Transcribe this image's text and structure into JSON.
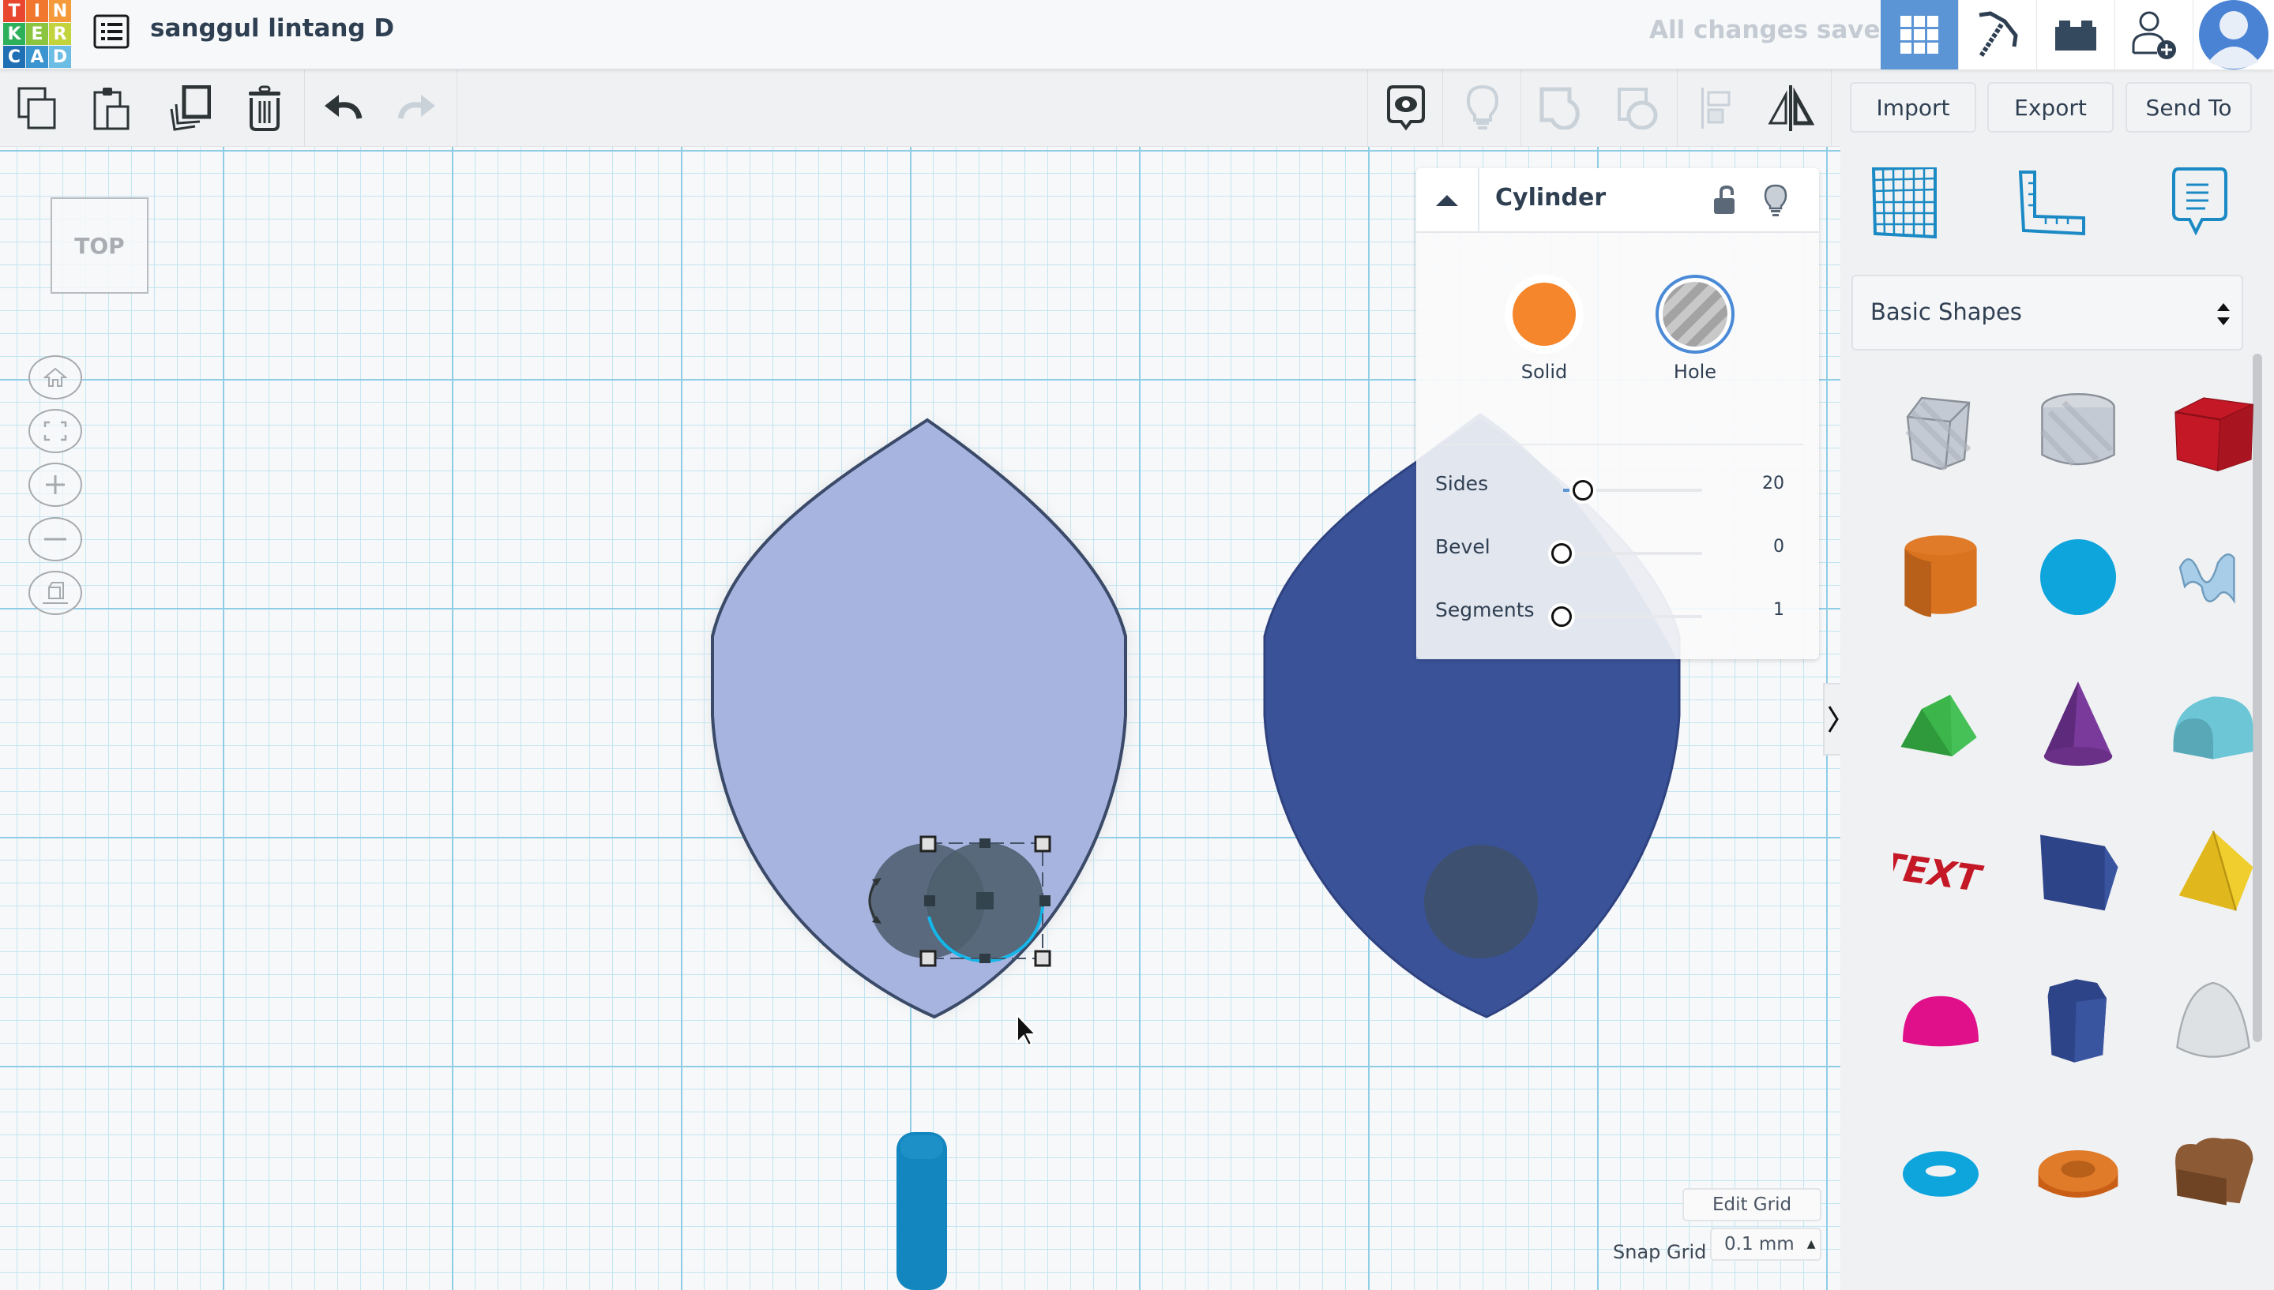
{
  "app": {
    "logo_letters": [
      "T",
      "I",
      "N",
      "K",
      "E",
      "R",
      "C",
      "A",
      "D"
    ],
    "logo_colors": [
      "#e8462f",
      "#f0772d",
      "#f59a3a",
      "#2cb05a",
      "#8bc53f",
      "#c2d33c",
      "#1f6fb5",
      "#3a94d0",
      "#6cbde3"
    ],
    "document_title": "sanggul lintang D",
    "save_status": "All changes saved"
  },
  "header_icons": [
    {
      "name": "3d-design-grid-icon",
      "active": true
    },
    {
      "name": "codeblocks-pickaxe-icon",
      "active": false
    },
    {
      "name": "lego-brick-icon",
      "active": false
    },
    {
      "name": "invite-user-icon",
      "active": false
    },
    {
      "name": "user-avatar-icon",
      "active": false
    }
  ],
  "toolbar": {
    "left_tools": [
      "copy",
      "paste",
      "duplicate",
      "delete",
      "undo",
      "redo"
    ],
    "right_tools": [
      "show-notes",
      "show-hide",
      "group",
      "ungroup",
      "align",
      "mirror"
    ],
    "import_label": "Import",
    "export_label": "Export",
    "send_to_label": "Send To"
  },
  "viewport": {
    "view_cube_label": "TOP",
    "nav_buttons": [
      "home-view",
      "fit-all",
      "zoom-in",
      "zoom-out",
      "perspective-toggle"
    ],
    "edit_grid_label": "Edit Grid",
    "snap_grid_label": "Snap Grid",
    "snap_grid_value": "0.1 mm"
  },
  "properties_panel": {
    "shape_name": "Cylinder",
    "solid_label": "Solid",
    "hole_label": "Hole",
    "selected_mode": "Hole",
    "solid_color": "#f5862c",
    "params": [
      {
        "label": "Sides",
        "value": "20",
        "fraction": 0.06
      },
      {
        "label": "Bevel",
        "value": "0",
        "fraction": 0.0
      },
      {
        "label": "Segments",
        "value": "1",
        "fraction": 0.0
      }
    ]
  },
  "shape_library": {
    "category": "Basic Shapes",
    "shapes": [
      "Box Hole",
      "Cylinder Hole",
      "Box",
      "Cylinder",
      "Sphere",
      "Scribble",
      "Roof",
      "Cone",
      "Round Roof",
      "Text",
      "Wedge",
      "Pyramid",
      "Half Sphere",
      "Polygon",
      "Paraboloid",
      "Torus",
      "Tube",
      "Heart"
    ]
  },
  "colors": {
    "accent": "#5b95d6",
    "shape_light": "#a8b4e0",
    "shape_dark": "#3a5298",
    "hole_overlay": "#4e5f6e",
    "panel_icon_blue": "#1b8ac4"
  }
}
